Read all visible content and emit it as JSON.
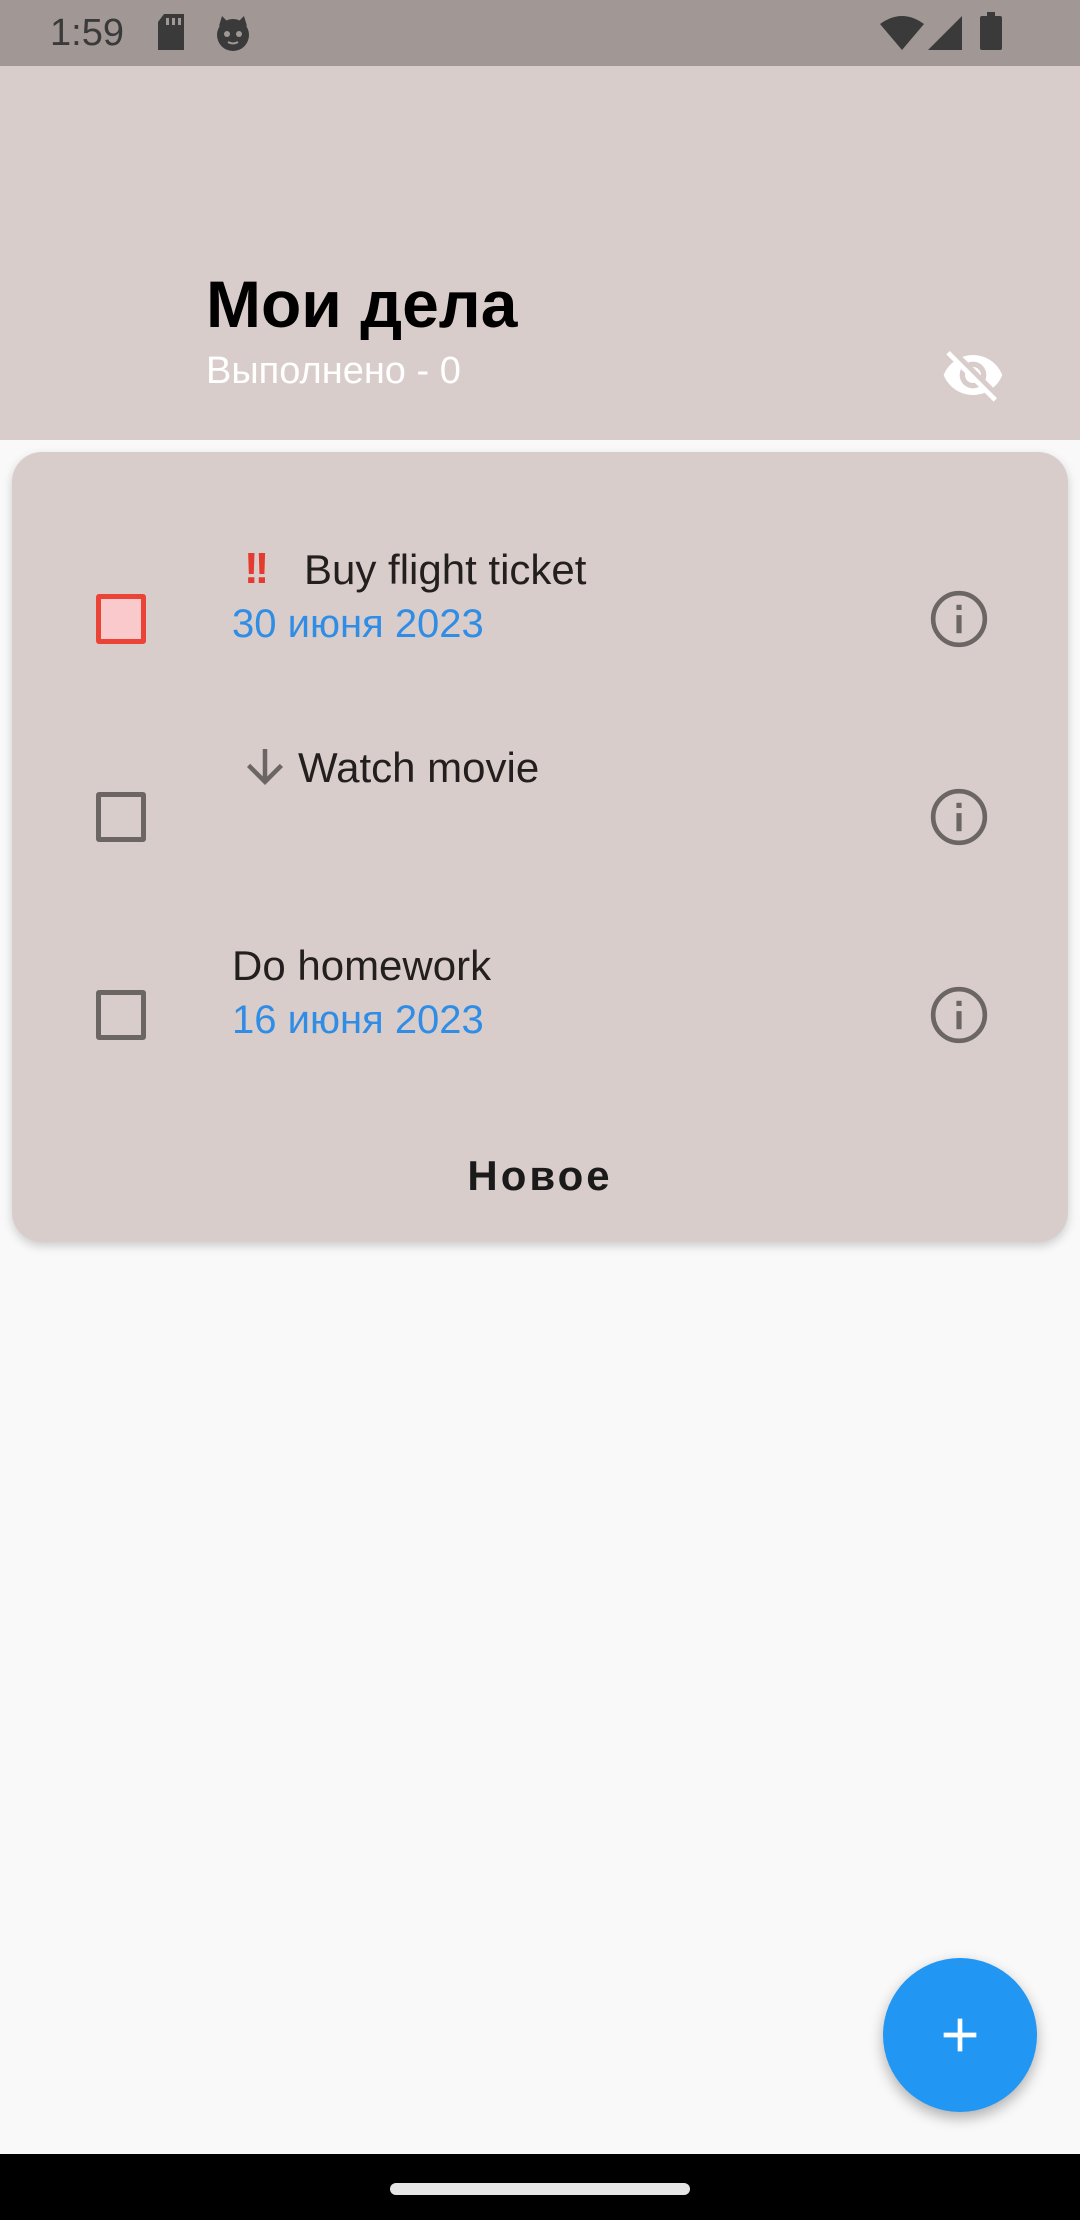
{
  "status_bar": {
    "time": "1:59",
    "icons": [
      "sd-card-icon",
      "cat-icon",
      "wifi-icon",
      "signal-icon",
      "battery-icon"
    ]
  },
  "app_bar": {
    "title": "Мои дела",
    "subtitle": "Выполнено - 0",
    "visibility_icon": "visibility-off-icon"
  },
  "tasks": [
    {
      "title": "Buy flight ticket",
      "priority": "high",
      "priority_badge": "!!",
      "date": "30 июня 2023",
      "checked": false
    },
    {
      "title": "Watch movie",
      "priority": "low",
      "priority_icon": "arrow-down-icon",
      "date": "",
      "checked": false
    },
    {
      "title": "Do homework",
      "priority": "none",
      "date": "16 июня 2023",
      "checked": false
    }
  ],
  "new_task_label": "Новое",
  "fab": {
    "icon": "plus-icon"
  },
  "colors": {
    "accent": "#2196f3",
    "header_bg": "#d8cdcb",
    "date_text": "#2f8de6",
    "priority_high": "#e53a2f",
    "checkbox_high_fill": "#f9c9cb"
  }
}
